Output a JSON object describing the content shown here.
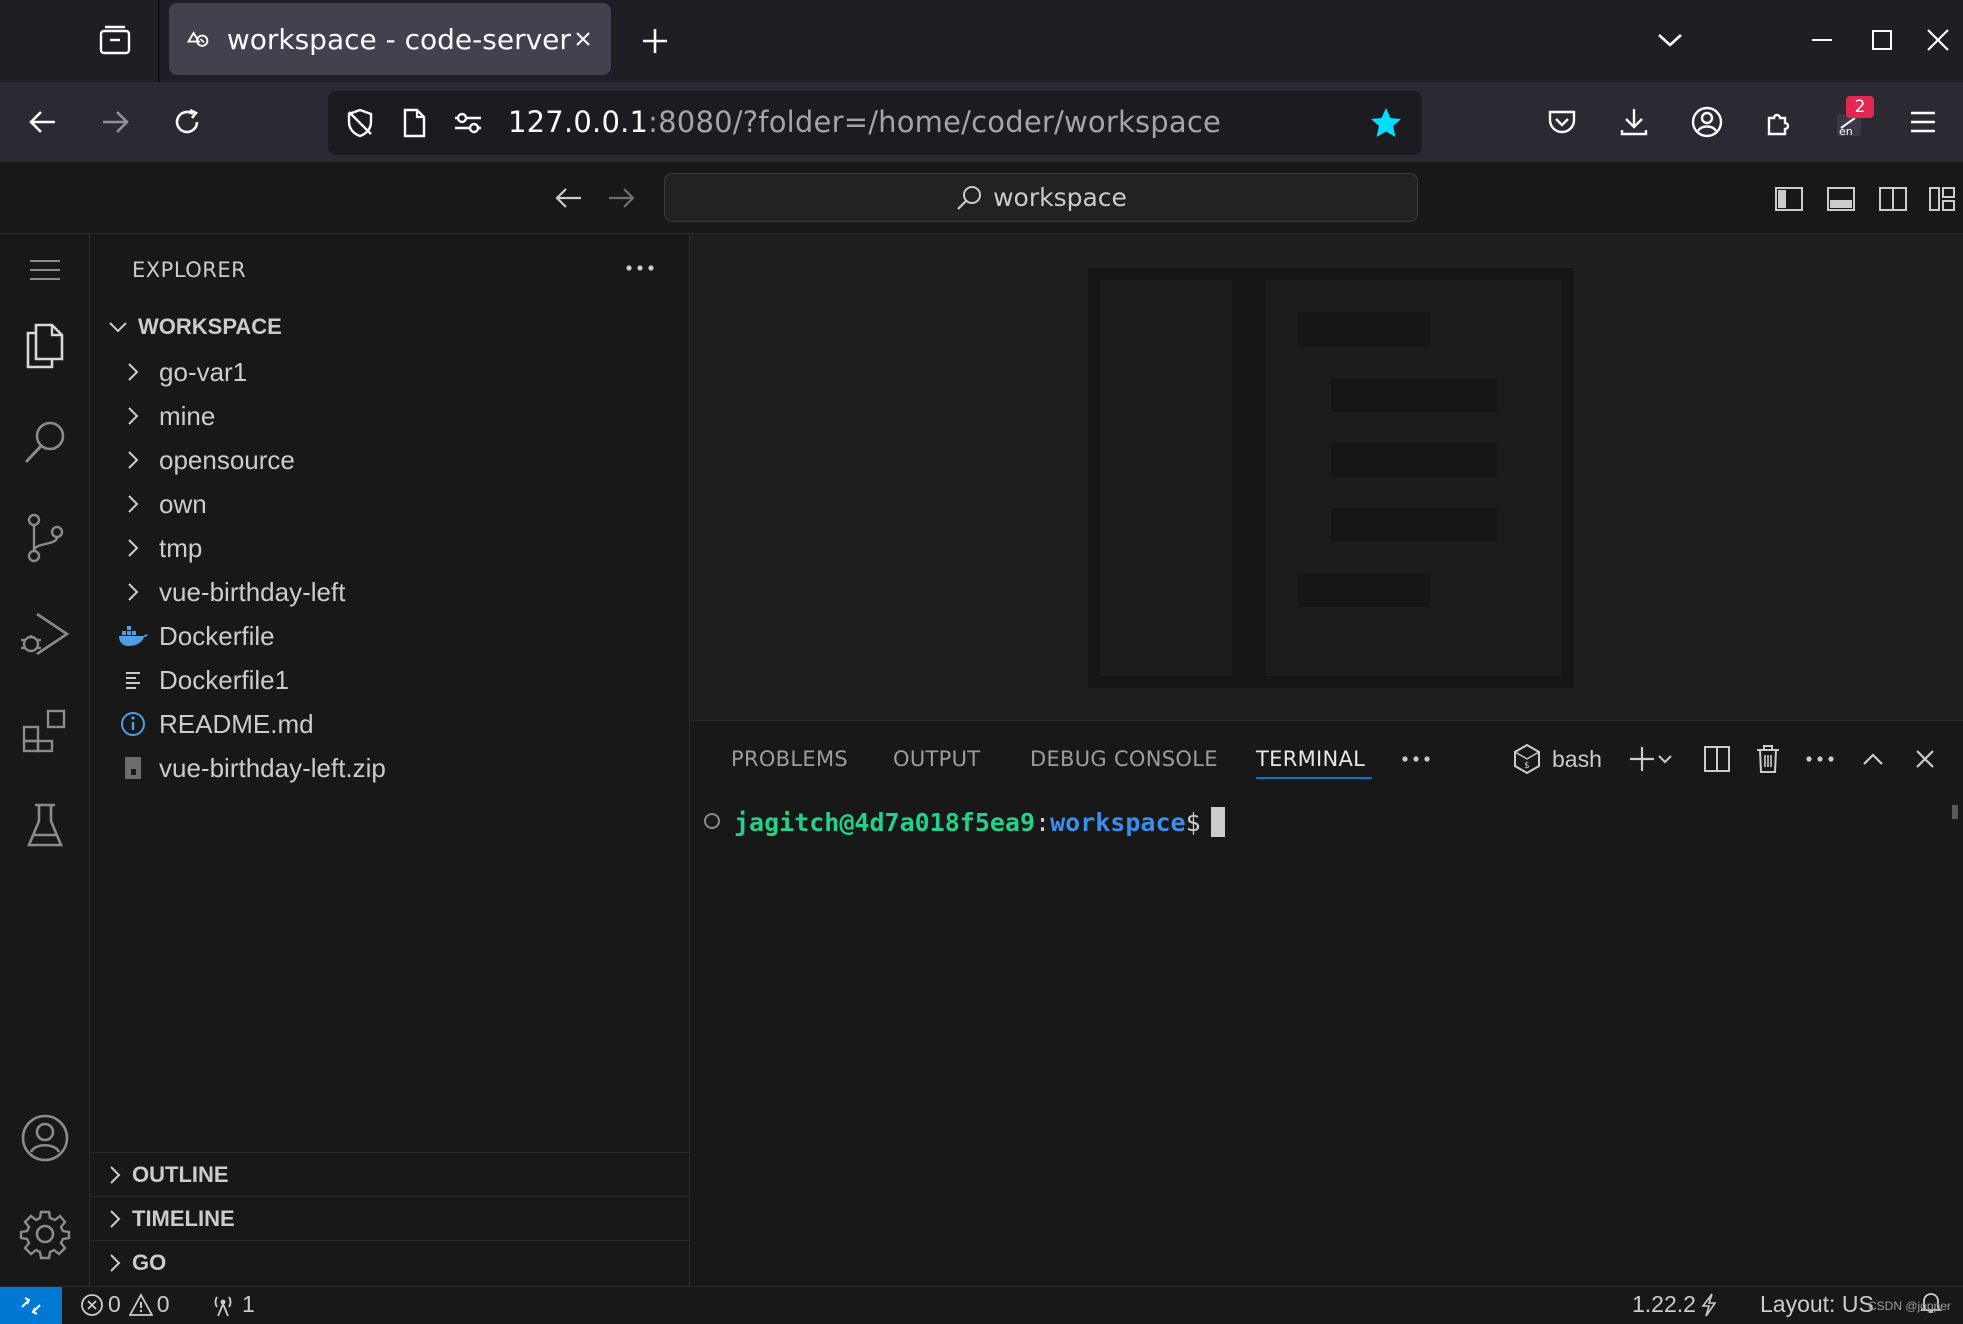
{
  "browser": {
    "tab_title": "workspace - code-server",
    "url_host": "127.0.0.1",
    "url_rest": ":8080/?folder=/home/coder/workspace",
    "extension_badge": "2",
    "extension_label": "en"
  },
  "titlebar": {
    "search_text": "workspace"
  },
  "sidebar": {
    "title": "EXPLORER",
    "workspace_label": "WORKSPACE",
    "items": [
      {
        "label": "go-var1",
        "kind": "folder",
        "icon": "chevron-right-icon"
      },
      {
        "label": "mine",
        "kind": "folder",
        "icon": "chevron-right-icon"
      },
      {
        "label": "opensource",
        "kind": "folder",
        "icon": "chevron-right-icon"
      },
      {
        "label": "own",
        "kind": "folder",
        "icon": "chevron-right-icon"
      },
      {
        "label": "tmp",
        "kind": "folder",
        "icon": "chevron-right-icon"
      },
      {
        "label": "vue-birthday-left",
        "kind": "folder",
        "icon": "chevron-right-icon"
      },
      {
        "label": "Dockerfile",
        "kind": "file",
        "icon": "docker-icon"
      },
      {
        "label": "Dockerfile1",
        "kind": "file",
        "icon": "text-lines-icon"
      },
      {
        "label": "README.md",
        "kind": "file",
        "icon": "info-icon"
      },
      {
        "label": "vue-birthday-left.zip",
        "kind": "file",
        "icon": "zip-icon"
      }
    ],
    "sections": [
      {
        "label": "OUTLINE"
      },
      {
        "label": "TIMELINE"
      },
      {
        "label": "GO"
      }
    ]
  },
  "panel": {
    "tabs": [
      "PROBLEMS",
      "OUTPUT",
      "DEBUG CONSOLE",
      "TERMINAL"
    ],
    "active_tab": "TERMINAL",
    "terminal_name": "bash",
    "prompt_user": "jagitch@4d7a018f5ea9",
    "prompt_colon": ":",
    "prompt_dir": "workspace",
    "prompt_dollar": "$"
  },
  "statusbar": {
    "errors": "0",
    "warnings": "0",
    "ports": "1",
    "go_version": "1.22.2",
    "layout": "Layout: US",
    "watermark": "CSDN @jopper"
  },
  "colors": {
    "accent": "#0078d4",
    "terminal_user": "#23d18b",
    "terminal_dir": "#3b8eea",
    "bookmark_star": "#00ddff",
    "badge": "#e22850"
  }
}
